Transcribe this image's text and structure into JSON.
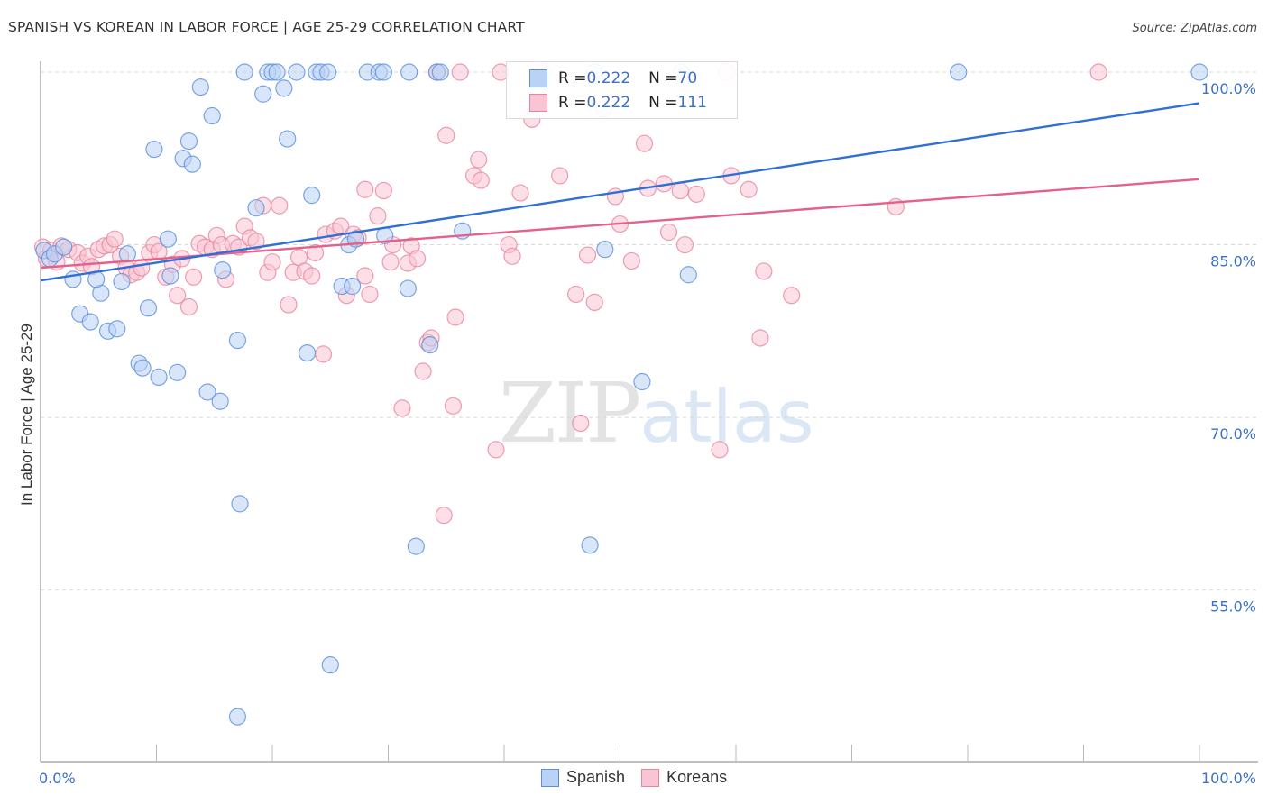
{
  "header": {
    "title": "SPANISH VS KOREAN IN LABOR FORCE | AGE 25-29 CORRELATION CHART",
    "source": "Source: ZipAtlas.com"
  },
  "watermark": {
    "zip": "ZIP",
    "atlas": "atlas"
  },
  "colors": {
    "spanish_fill": "#b9d2f5",
    "spanish_stroke": "#5b8fdc",
    "spanish_line": "#2f6fd6",
    "koreans_fill": "#f9c4d3",
    "koreans_stroke": "#e8849f",
    "koreans_line": "#e5608a",
    "tick_label": "#3b6fc8",
    "grid": "#d8d8d8"
  },
  "legend": {
    "rows": [
      {
        "series": "Spanish",
        "r_label": "R = ",
        "r_value": "0.222",
        "n_label": "N = ",
        "n_value": "70"
      },
      {
        "series": "Koreans",
        "r_label": "R = ",
        "r_value": "0.222",
        "n_label": "N = ",
        "n_value": "111"
      }
    ]
  },
  "bottom_legend": {
    "items": [
      {
        "label": "Spanish"
      },
      {
        "label": "Koreans"
      }
    ]
  },
  "chart_data": {
    "type": "scatter",
    "title": "SPANISH VS KOREAN IN LABOR FORCE | AGE 25-29 CORRELATION CHART",
    "xlabel": "",
    "ylabel": "In Labor Force | Age 25-29",
    "xlim": [
      0,
      100
    ],
    "ylim": [
      40,
      100
    ],
    "x_tick_labels": [
      "0.0%",
      "100.0%"
    ],
    "y_ticks": [
      {
        "value": 100,
        "label": "100.0%"
      },
      {
        "value": 85,
        "label": "85.0%"
      },
      {
        "value": 70,
        "label": "70.0%"
      },
      {
        "value": 55,
        "label": "55.0%"
      }
    ],
    "grid": true,
    "legend_position": "top-center",
    "series": [
      {
        "name": "Spanish",
        "R": 0.222,
        "N": 70,
        "trendline": {
          "x": [
            0,
            100
          ],
          "y": [
            81.9,
            97.3
          ]
        },
        "points": [
          [
            0.3,
            84.5
          ],
          [
            0.8,
            83.8
          ],
          [
            1.2,
            84.2
          ],
          [
            2.0,
            84.8
          ],
          [
            2.8,
            82.0
          ],
          [
            3.4,
            79.0
          ],
          [
            4.3,
            78.3
          ],
          [
            5.2,
            80.8
          ],
          [
            4.8,
            82.0
          ],
          [
            5.8,
            77.5
          ],
          [
            6.6,
            77.7
          ],
          [
            7.0,
            81.8
          ],
          [
            7.5,
            84.2
          ],
          [
            8.5,
            74.7
          ],
          [
            8.8,
            74.3
          ],
          [
            9.3,
            79.5
          ],
          [
            9.8,
            93.3
          ],
          [
            10.2,
            73.5
          ],
          [
            11.0,
            85.5
          ],
          [
            11.2,
            82.3
          ],
          [
            11.8,
            73.9
          ],
          [
            12.3,
            92.5
          ],
          [
            12.8,
            94.0
          ],
          [
            13.1,
            92.0
          ],
          [
            13.8,
            98.7
          ],
          [
            14.4,
            72.2
          ],
          [
            14.8,
            96.2
          ],
          [
            15.5,
            71.4
          ],
          [
            15.7,
            82.8
          ],
          [
            17.0,
            76.7
          ],
          [
            17.2,
            62.5
          ],
          [
            17.0,
            44.0
          ],
          [
            17.6,
            100.0
          ],
          [
            18.6,
            88.2
          ],
          [
            19.2,
            98.1
          ],
          [
            19.6,
            100.0
          ],
          [
            20.0,
            100.0
          ],
          [
            20.4,
            100.0
          ],
          [
            21.0,
            98.6
          ],
          [
            21.3,
            94.2
          ],
          [
            22.1,
            100.0
          ],
          [
            23.0,
            75.6
          ],
          [
            23.4,
            89.3
          ],
          [
            23.8,
            100.0
          ],
          [
            24.2,
            100.0
          ],
          [
            24.8,
            100.0
          ],
          [
            25.0,
            48.5
          ],
          [
            26.0,
            81.4
          ],
          [
            26.6,
            85.0
          ],
          [
            26.9,
            81.4
          ],
          [
            27.2,
            85.5
          ],
          [
            28.2,
            100.0
          ],
          [
            29.2,
            100.0
          ],
          [
            29.6,
            100.0
          ],
          [
            29.7,
            85.8
          ],
          [
            31.8,
            100.0
          ],
          [
            31.7,
            81.2
          ],
          [
            32.4,
            58.8
          ],
          [
            33.6,
            76.3
          ],
          [
            34.2,
            100.0
          ],
          [
            34.5,
            100.0
          ],
          [
            36.4,
            86.2
          ],
          [
            47.8,
            100.0
          ],
          [
            47.4,
            58.9
          ],
          [
            48.7,
            84.6
          ],
          [
            51.9,
            73.1
          ],
          [
            55.3,
            100.0
          ],
          [
            55.9,
            82.4
          ],
          [
            79.2,
            100.0
          ],
          [
            100.0,
            100.0
          ]
        ]
      },
      {
        "name": "Koreans",
        "R": 0.222,
        "N": 111,
        "trendline": {
          "x": [
            0,
            100
          ],
          "y": [
            83.0,
            90.7
          ]
        },
        "points": [
          [
            0.2,
            84.8
          ],
          [
            0.5,
            83.8
          ],
          [
            0.9,
            84.5
          ],
          [
            1.4,
            83.5
          ],
          [
            1.8,
            84.9
          ],
          [
            2.4,
            84.6
          ],
          [
            3.2,
            84.3
          ],
          [
            3.6,
            83.4
          ],
          [
            4.1,
            84.0
          ],
          [
            4.4,
            83.1
          ],
          [
            5.0,
            84.6
          ],
          [
            5.5,
            84.9
          ],
          [
            6.0,
            85.0
          ],
          [
            6.4,
            85.5
          ],
          [
            6.9,
            84.0
          ],
          [
            7.4,
            83.0
          ],
          [
            7.8,
            82.4
          ],
          [
            8.3,
            82.6
          ],
          [
            8.7,
            83.0
          ],
          [
            9.4,
            84.3
          ],
          [
            9.8,
            85.0
          ],
          [
            10.2,
            84.4
          ],
          [
            10.8,
            82.2
          ],
          [
            11.4,
            83.3
          ],
          [
            11.8,
            80.6
          ],
          [
            12.2,
            83.8
          ],
          [
            12.8,
            79.6
          ],
          [
            13.2,
            82.2
          ],
          [
            13.7,
            85.1
          ],
          [
            14.2,
            84.8
          ],
          [
            14.8,
            84.6
          ],
          [
            15.2,
            85.8
          ],
          [
            15.6,
            85.0
          ],
          [
            16.0,
            82.0
          ],
          [
            16.6,
            85.1
          ],
          [
            17.1,
            84.8
          ],
          [
            17.6,
            86.6
          ],
          [
            18.1,
            85.6
          ],
          [
            18.6,
            85.3
          ],
          [
            19.2,
            88.4
          ],
          [
            19.6,
            82.6
          ],
          [
            20.0,
            83.5
          ],
          [
            20.6,
            88.4
          ],
          [
            21.4,
            79.8
          ],
          [
            21.8,
            82.6
          ],
          [
            22.3,
            83.9
          ],
          [
            22.8,
            82.7
          ],
          [
            23.4,
            82.3
          ],
          [
            23.7,
            84.3
          ],
          [
            24.4,
            75.5
          ],
          [
            24.6,
            85.9
          ],
          [
            25.4,
            86.2
          ],
          [
            25.9,
            86.6
          ],
          [
            26.4,
            80.6
          ],
          [
            27.0,
            85.9
          ],
          [
            27.4,
            85.6
          ],
          [
            28.0,
            82.3
          ],
          [
            28.4,
            80.7
          ],
          [
            28.0,
            89.8
          ],
          [
            29.1,
            87.5
          ],
          [
            29.6,
            89.7
          ],
          [
            30.2,
            83.5
          ],
          [
            30.4,
            85.0
          ],
          [
            31.2,
            70.8
          ],
          [
            31.7,
            83.4
          ],
          [
            32.0,
            84.9
          ],
          [
            32.5,
            83.8
          ],
          [
            33.0,
            74.0
          ],
          [
            33.4,
            76.5
          ],
          [
            33.7,
            76.9
          ],
          [
            34.2,
            100.0
          ],
          [
            34.8,
            61.5
          ],
          [
            35.0,
            94.5
          ],
          [
            35.6,
            71.0
          ],
          [
            35.8,
            78.7
          ],
          [
            36.2,
            100.0
          ],
          [
            37.4,
            91.0
          ],
          [
            37.8,
            92.4
          ],
          [
            38.0,
            90.6
          ],
          [
            39.3,
            67.2
          ],
          [
            39.7,
            100.0
          ],
          [
            40.4,
            85.0
          ],
          [
            40.7,
            84.0
          ],
          [
            41.4,
            89.5
          ],
          [
            42.4,
            95.9
          ],
          [
            43.4,
            100.0
          ],
          [
            44.8,
            91.0
          ],
          [
            46.2,
            80.7
          ],
          [
            46.6,
            69.5
          ],
          [
            47.2,
            84.1
          ],
          [
            47.8,
            80.0
          ],
          [
            48.6,
            96.8
          ],
          [
            49.6,
            89.2
          ],
          [
            50.0,
            86.8
          ],
          [
            51.0,
            83.6
          ],
          [
            52.1,
            93.8
          ],
          [
            52.4,
            89.9
          ],
          [
            53.8,
            90.3
          ],
          [
            54.2,
            86.1
          ],
          [
            55.2,
            89.7
          ],
          [
            55.6,
            85.0
          ],
          [
            56.6,
            89.4
          ],
          [
            58.6,
            67.2
          ],
          [
            59.2,
            100.0
          ],
          [
            59.6,
            91.0
          ],
          [
            61.1,
            89.8
          ],
          [
            62.1,
            76.9
          ],
          [
            62.4,
            82.7
          ],
          [
            64.8,
            80.6
          ],
          [
            73.8,
            88.3
          ],
          [
            91.3,
            100.0
          ]
        ]
      }
    ]
  }
}
